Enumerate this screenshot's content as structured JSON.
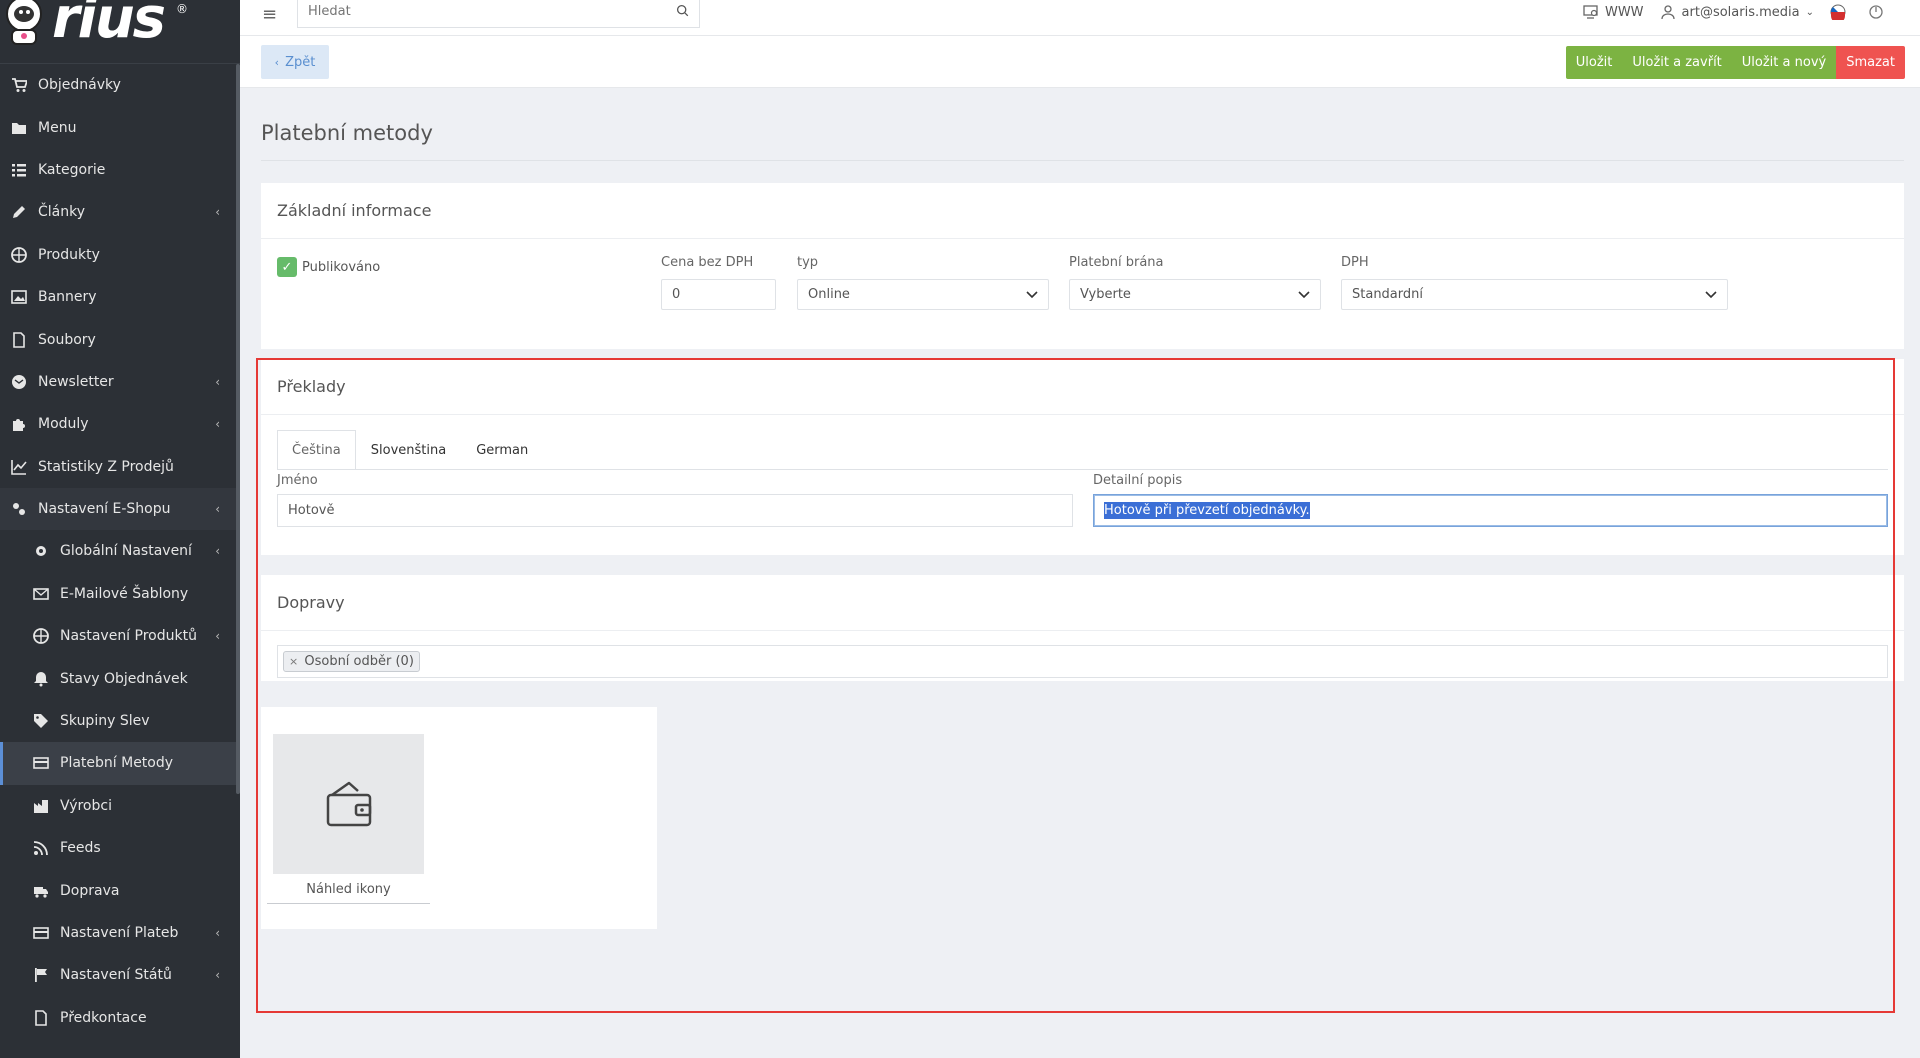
{
  "logo": {
    "text": "rius",
    "reg": "®"
  },
  "sidebar": {
    "items": [
      {
        "label": "Objednávky",
        "icon": "cart-icon",
        "chevron": false,
        "sub": false
      },
      {
        "label": "Menu",
        "icon": "folder-icon",
        "chevron": false,
        "sub": false
      },
      {
        "label": "Kategorie",
        "icon": "list-icon",
        "chevron": false,
        "sub": false
      },
      {
        "label": "Články",
        "icon": "pencil-icon",
        "chevron": true,
        "sub": false
      },
      {
        "label": "Produkty",
        "icon": "basketball-icon",
        "chevron": false,
        "sub": false
      },
      {
        "label": "Bannery",
        "icon": "image-icon",
        "chevron": false,
        "sub": false
      },
      {
        "label": "Soubory",
        "icon": "file-icon",
        "chevron": false,
        "sub": false
      },
      {
        "label": "Newsletter",
        "icon": "envelope-circle-icon",
        "chevron": true,
        "sub": false
      },
      {
        "label": "Moduly",
        "icon": "puzzle-icon",
        "chevron": true,
        "sub": false
      },
      {
        "label": "Statistiky Z Prodejů",
        "icon": "chart-line-icon",
        "chevron": false,
        "sub": false
      },
      {
        "label": "Nastavení E-Shopu",
        "icon": "settings-shop-icon",
        "chevron": true,
        "sub": false,
        "expanded": true
      },
      {
        "label": "Globální Nastavení",
        "icon": "gear-icon",
        "chevron": true,
        "sub": true
      },
      {
        "label": "E-Mailové Šablony",
        "icon": "mail-icon",
        "chevron": false,
        "sub": true
      },
      {
        "label": "Nastavení Produktů",
        "icon": "basketball-icon",
        "chevron": true,
        "sub": true
      },
      {
        "label": "Stavy Objednávek",
        "icon": "bell-icon",
        "chevron": false,
        "sub": true
      },
      {
        "label": "Skupiny Slev",
        "icon": "tag-icon",
        "chevron": false,
        "sub": true
      },
      {
        "label": "Platební Metody",
        "icon": "credit-card-icon",
        "chevron": false,
        "sub": true,
        "active": true
      },
      {
        "label": "Výrobci",
        "icon": "factory-icon",
        "chevron": false,
        "sub": true
      },
      {
        "label": "Feeds",
        "icon": "feed-icon",
        "chevron": false,
        "sub": true
      },
      {
        "label": "Doprava",
        "icon": "truck-icon",
        "chevron": false,
        "sub": true
      },
      {
        "label": "Nastavení Plateb",
        "icon": "credit-card-icon",
        "chevron": true,
        "sub": true
      },
      {
        "label": "Nastavení Států",
        "icon": "flag-icon",
        "chevron": true,
        "sub": true
      },
      {
        "label": "Předkontace",
        "icon": "file-icon",
        "chevron": false,
        "sub": true
      }
    ]
  },
  "topbar": {
    "search_placeholder": "Hledat",
    "www": "WWW",
    "user": "art@solaris.media"
  },
  "actions": {
    "back": "Zpět",
    "save": "Uložit",
    "save_close": "Uložit a zavřít",
    "save_new": "Uložit a nový",
    "delete": "Smazat"
  },
  "page": {
    "title": "Platební metody"
  },
  "basic": {
    "heading": "Základní informace",
    "published_label": "Publikováno",
    "published": true,
    "price_label": "Cena bez DPH",
    "price_value": "0",
    "type_label": "typ",
    "type_value": "Online",
    "gateway_label": "Platební brána",
    "gateway_value": "Vyberte",
    "vat_label": "DPH",
    "vat_value": "Standardní"
  },
  "translations": {
    "heading": "Překlady",
    "tabs": [
      "Čeština",
      "Slovenština",
      "German"
    ],
    "name_label": "Jméno",
    "name_value": "Hotově",
    "desc_label": "Detailní popis",
    "desc_value": "Hotově při převzetí objednávky."
  },
  "shipping": {
    "heading": "Dopravy",
    "tag_remove": "×",
    "tag": "Osobní odběr (0)"
  },
  "icon_preview": {
    "caption": "Náhled ikony"
  },
  "colors": {
    "sidebar_bg": "#2c3036",
    "green": "#7cb342",
    "red": "#ef5350",
    "back_bg": "#dce8f6",
    "highlight": "#e53935"
  }
}
